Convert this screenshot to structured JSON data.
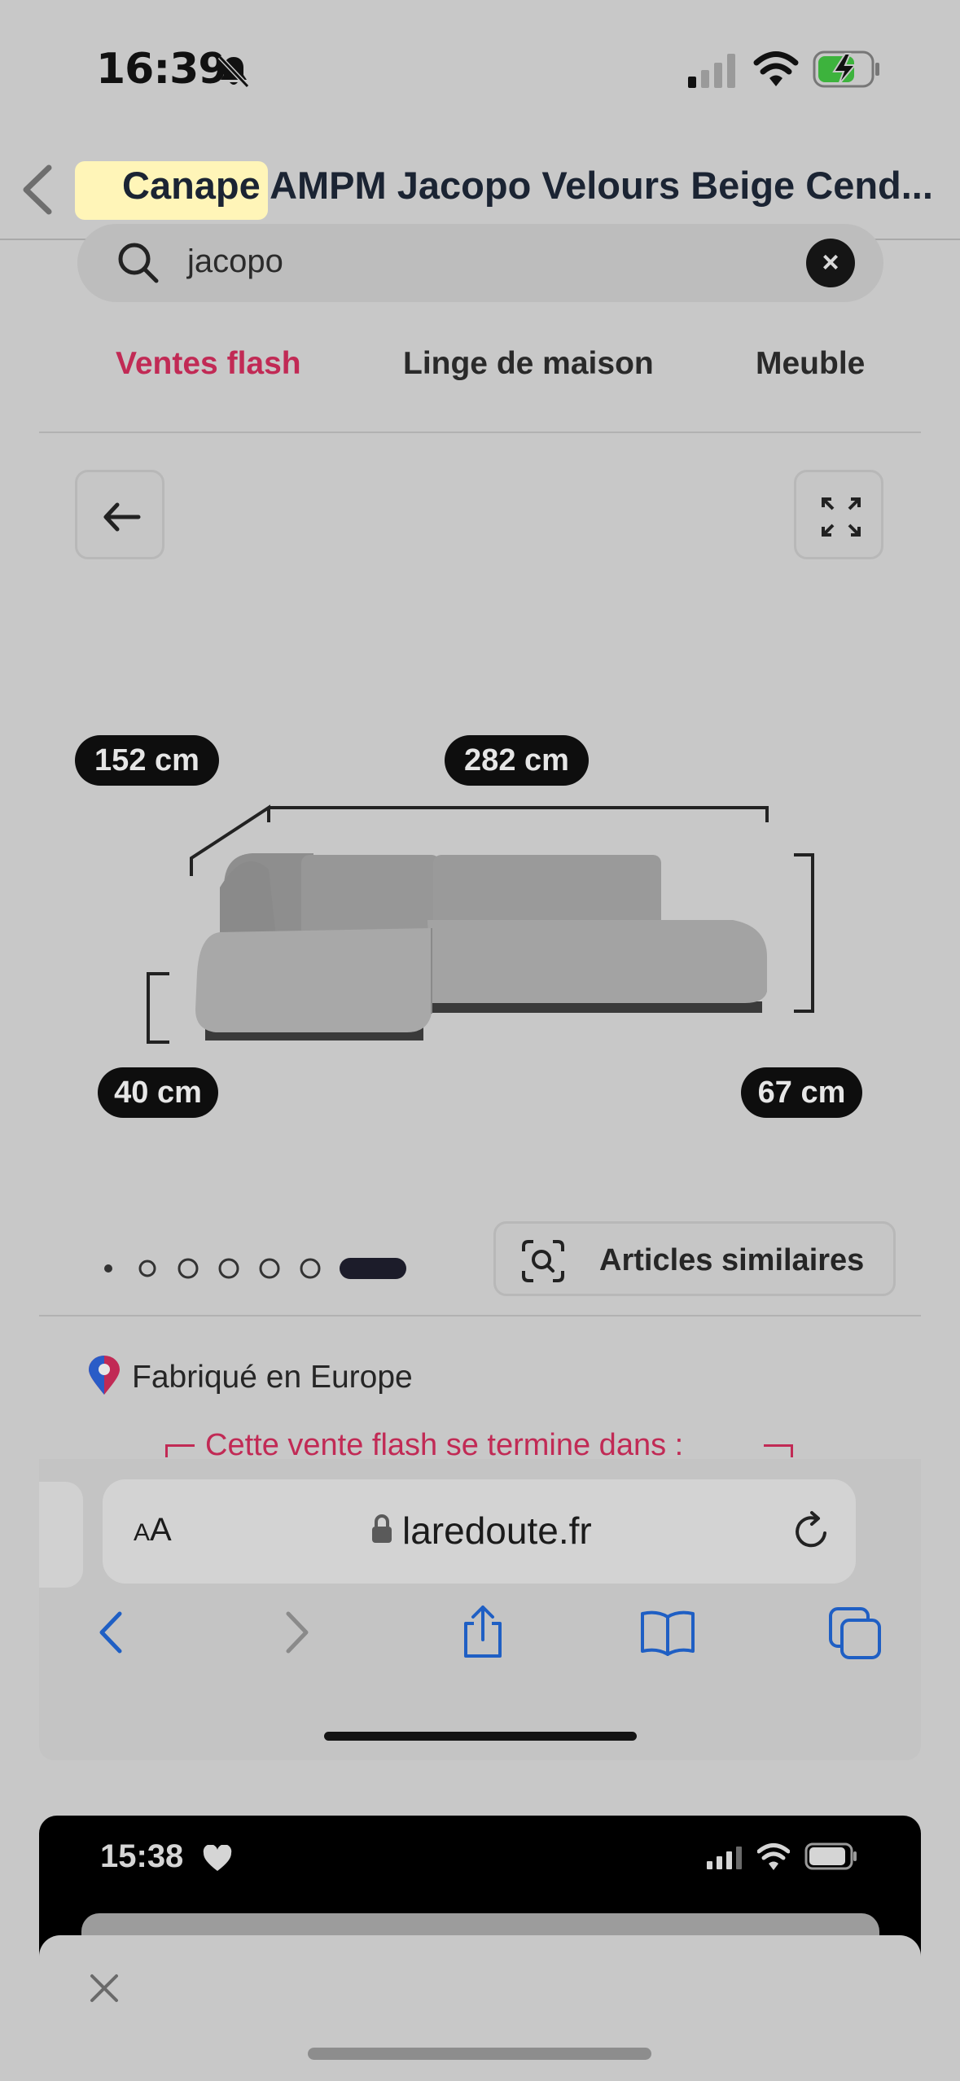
{
  "status_bar": {
    "time": "16:39",
    "icons": [
      "bell-slash-icon",
      "cellular-signal-icon",
      "wifi-icon",
      "battery-charging-icon"
    ]
  },
  "nav": {
    "title": "Canape AMPM Jacopo Velours Beige Cend...",
    "highlighted_word": "Canape",
    "highlight_color": "#fff5b8"
  },
  "search": {
    "value": "jacopo"
  },
  "categories": [
    {
      "label": "Ventes flash",
      "active": true
    },
    {
      "label": "Linge de maison",
      "active": false
    },
    {
      "label": "Meuble",
      "active": false
    }
  ],
  "product": {
    "dimensions": {
      "depth": "152 cm",
      "width": "282 cm",
      "seat_height": "40 cm",
      "height": "67 cm"
    },
    "carousel": {
      "total": 7,
      "active_index": 6
    },
    "similar_label": "Articles similaires",
    "origin": "Fabriqué en Europe",
    "flash_sale_text": "Cette vente flash se termine dans :"
  },
  "browser": {
    "aa_label": "AA",
    "url": "laredoute.fr",
    "toolbar": [
      "back-icon",
      "forward-icon",
      "share-icon",
      "bookmarks-icon",
      "tabs-icon"
    ]
  },
  "second_screen": {
    "time": "15:38"
  },
  "colors": {
    "accent": "#c12a55",
    "link_blue": "#1f5fc4"
  }
}
